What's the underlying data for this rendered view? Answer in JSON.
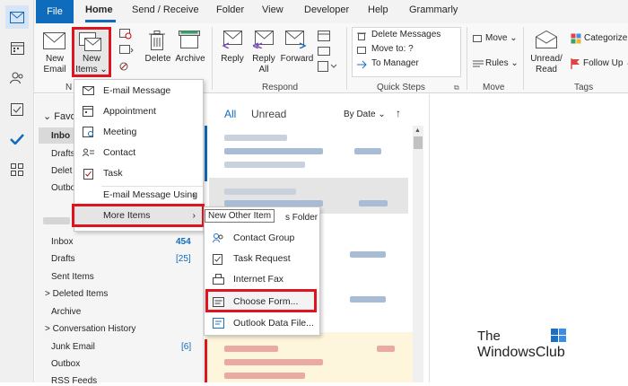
{
  "tabs": {
    "file": "File",
    "home": "Home",
    "send_receive": "Send / Receive",
    "folder": "Folder",
    "view": "View",
    "developer": "Developer",
    "help": "Help",
    "grammarly": "Grammarly"
  },
  "ribbon": {
    "new_email": "New\nEmail",
    "new_items": "New\nItems ⌄",
    "delete": "Delete",
    "archive": "Archive",
    "reply": "Reply",
    "reply_all": "Reply\nAll",
    "forward": "Forward",
    "quick_steps": {
      "delete_messages": "Delete Messages",
      "move_to": "Move to: ?",
      "to_manager": "To Manager"
    },
    "move_label": "Move ⌄",
    "rules_label": "Rules ⌄",
    "unread_read": "Unread/\nRead",
    "categorize": "Categorize ⌄",
    "follow_up": "Follow Up ⌄",
    "groups": {
      "new": "N",
      "respond": "Respond",
      "quick_steps": "Quick Steps",
      "move": "Move",
      "tags": "Tags"
    }
  },
  "folder_pane": {
    "favorites": "Favo",
    "inbox_fav": "Inbo",
    "drafts_fav": "Drafts",
    "deleted_fav": "Delet",
    "outbox_fav": "Outbo",
    "items": [
      {
        "label": "Inbox",
        "count": "454"
      },
      {
        "label": "Drafts",
        "count": "[25]"
      },
      {
        "label": "Sent Items",
        "count": ""
      },
      {
        "label": "> Deleted Items",
        "count": ""
      },
      {
        "label": "Archive",
        "count": ""
      },
      {
        "label": "> Conversation History",
        "count": ""
      },
      {
        "label": "Junk Email",
        "count": "[6]"
      },
      {
        "label": "Outbox",
        "count": ""
      },
      {
        "label": "RSS Feeds",
        "count": ""
      }
    ]
  },
  "message_list": {
    "all_tab": "All",
    "unread_tab": "Unread",
    "sort": "By Date ⌄",
    "sort_arrow": "↑"
  },
  "new_items_menu": {
    "items": [
      "E-mail Message",
      "Appointment",
      "Meeting",
      "Contact",
      "Task",
      "E-mail Message Using",
      "More Items"
    ]
  },
  "more_items_menu": {
    "tooltip": "New Other Item",
    "partial_first": "s Folder",
    "items": [
      "Contact Group",
      "Task Request",
      "Internet Fax",
      "Choose Form...",
      "Outlook Data File..."
    ]
  },
  "watermark": {
    "line1": "The",
    "line2": "WindowsClub"
  },
  "colors": {
    "accent": "#0f6cbd",
    "highlight_red": "#e0141e"
  }
}
